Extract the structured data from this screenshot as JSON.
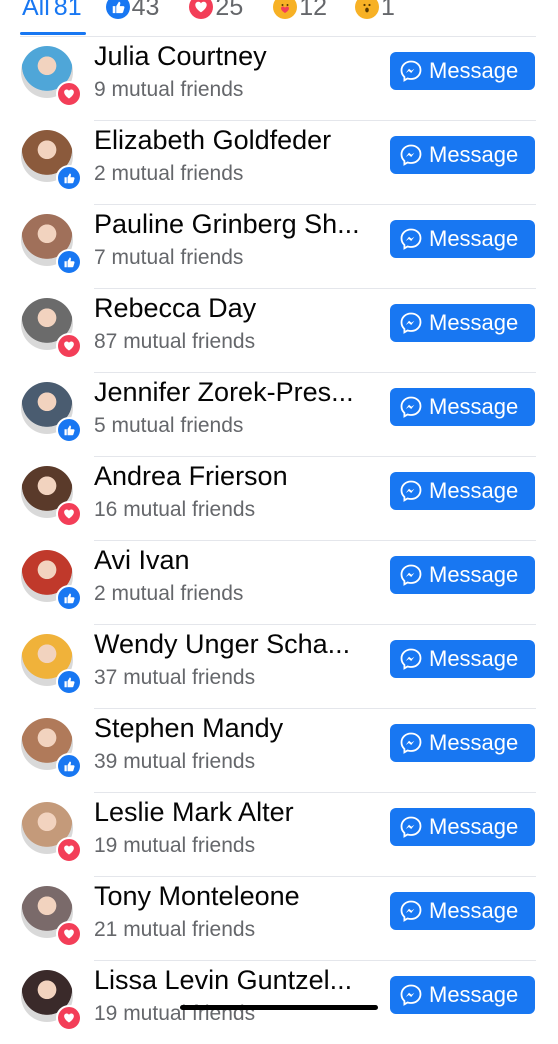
{
  "tabs": {
    "all_label": "All",
    "all_count": "81",
    "like_count": "43",
    "love_count": "25",
    "care_count": "12",
    "wow_count": "1"
  },
  "button_label": "Message",
  "people": [
    {
      "name": "Julia Courtney",
      "mutual": "9 mutual friends",
      "reaction": "love",
      "avatar_color": "#4fa6d8"
    },
    {
      "name": "Elizabeth Goldfeder",
      "mutual": "2 mutual friends",
      "reaction": "like",
      "avatar_color": "#8b5a3c"
    },
    {
      "name": "Pauline Grinberg Sh...",
      "mutual": "7 mutual friends",
      "reaction": "like",
      "avatar_color": "#a0705a"
    },
    {
      "name": "Rebecca Day",
      "mutual": "87 mutual friends",
      "reaction": "love",
      "avatar_color": "#6b6b6b"
    },
    {
      "name": "Jennifer Zorek-Pres...",
      "mutual": "5 mutual friends",
      "reaction": "like",
      "avatar_color": "#4a5c70"
    },
    {
      "name": "Andrea Frierson",
      "mutual": "16 mutual friends",
      "reaction": "love",
      "avatar_color": "#5a3a2a"
    },
    {
      "name": "Avi Ivan",
      "mutual": "2 mutual friends",
      "reaction": "like",
      "avatar_color": "#c0392b"
    },
    {
      "name": "Wendy Unger Scha...",
      "mutual": "37 mutual friends",
      "reaction": "like",
      "avatar_color": "#f0b23a"
    },
    {
      "name": "Stephen Mandy",
      "mutual": "39 mutual friends",
      "reaction": "like",
      "avatar_color": "#b07a5a"
    },
    {
      "name": "Leslie Mark Alter",
      "mutual": "19 mutual friends",
      "reaction": "love",
      "avatar_color": "#c49a7a"
    },
    {
      "name": "Tony Monteleone",
      "mutual": "21 mutual friends",
      "reaction": "love",
      "avatar_color": "#7a6a6a"
    },
    {
      "name": "Lissa Levin Guntzel...",
      "mutual": "19 mutual friends",
      "reaction": "love",
      "avatar_color": "#3a2a2a"
    }
  ],
  "colors": {
    "accent": "#1877f2",
    "love": "#f33e58",
    "secondary_text": "#65676b"
  },
  "icons": {
    "like": "like-icon",
    "love": "love-icon",
    "care": "care-icon",
    "wow": "wow-icon",
    "message": "messenger-icon"
  }
}
